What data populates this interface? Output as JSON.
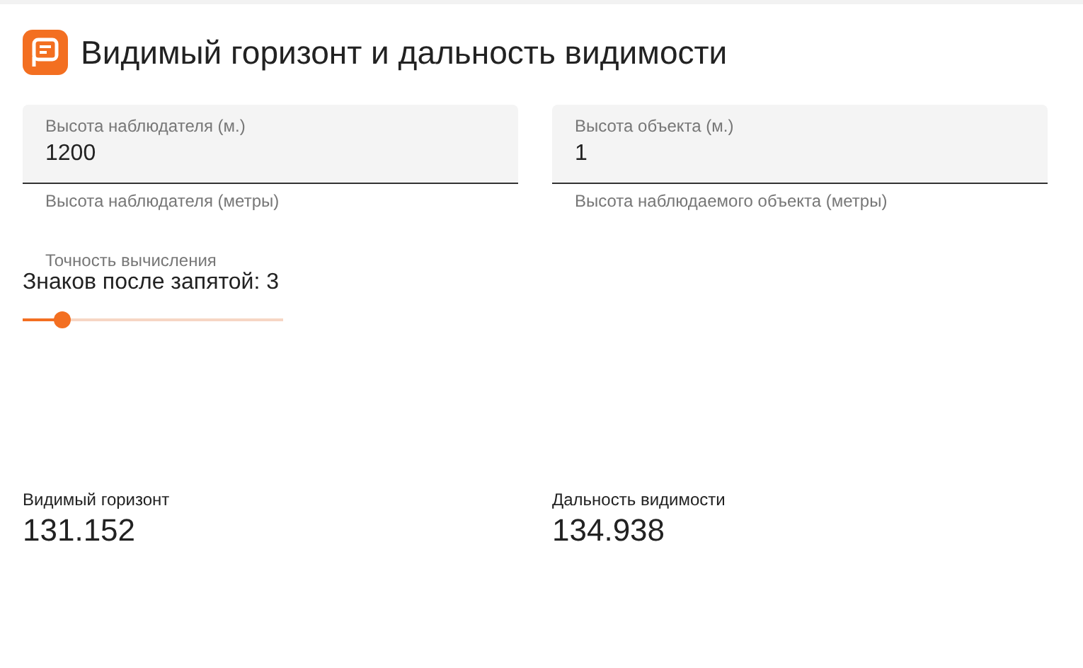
{
  "title": "Видимый горизонт и дальность видимости",
  "fields": [
    {
      "label": "Высота наблюдателя (м.)",
      "value": "1200",
      "helper": "Высота наблюдателя (метры)"
    },
    {
      "label": "Высота объекта (м.)",
      "value": "1",
      "helper": "Высота наблюдаемого объекта (метры)"
    }
  ],
  "precision": {
    "label": "Точность вычисления",
    "value_text": "Знаков после запятой: 3",
    "level": 0.15
  },
  "results": [
    {
      "label": "Видимый горизонт",
      "value": "131.152"
    },
    {
      "label": "Дальность видимости",
      "value": "134.938"
    }
  ]
}
